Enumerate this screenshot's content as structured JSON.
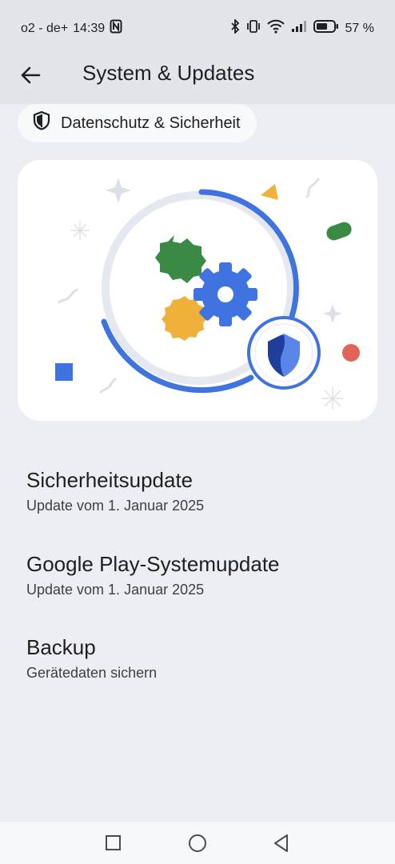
{
  "status_bar": {
    "carrier": "o2 - de+",
    "time": "14:39",
    "battery_percent": "57 %",
    "icons": [
      "nfc-icon",
      "bluetooth-icon",
      "vibrate-icon",
      "wifi-icon",
      "signal-icon",
      "battery-icon"
    ]
  },
  "app_bar": {
    "back_icon": "arrow-left-icon",
    "title": "System & Updates"
  },
  "chip": {
    "icon": "shield-icon",
    "label": "Datenschutz & Sicherheit"
  },
  "hero": {
    "colors": {
      "blue": "#3f74e0",
      "green": "#3a8a45",
      "yellow": "#f0b13a",
      "red": "#e06458",
      "ring": "#e5e8ee"
    }
  },
  "items": [
    {
      "title": "Sicherheitsupdate",
      "subtitle": "Update vom 1. Januar 2025"
    },
    {
      "title": "Google Play-Systemupdate",
      "subtitle": "Update vom 1. Januar 2025"
    },
    {
      "title": "Backup",
      "subtitle": "Gerätedaten sichern"
    }
  ],
  "nav": {
    "icons": [
      "recents-icon",
      "home-icon",
      "back-triangle-icon"
    ]
  }
}
